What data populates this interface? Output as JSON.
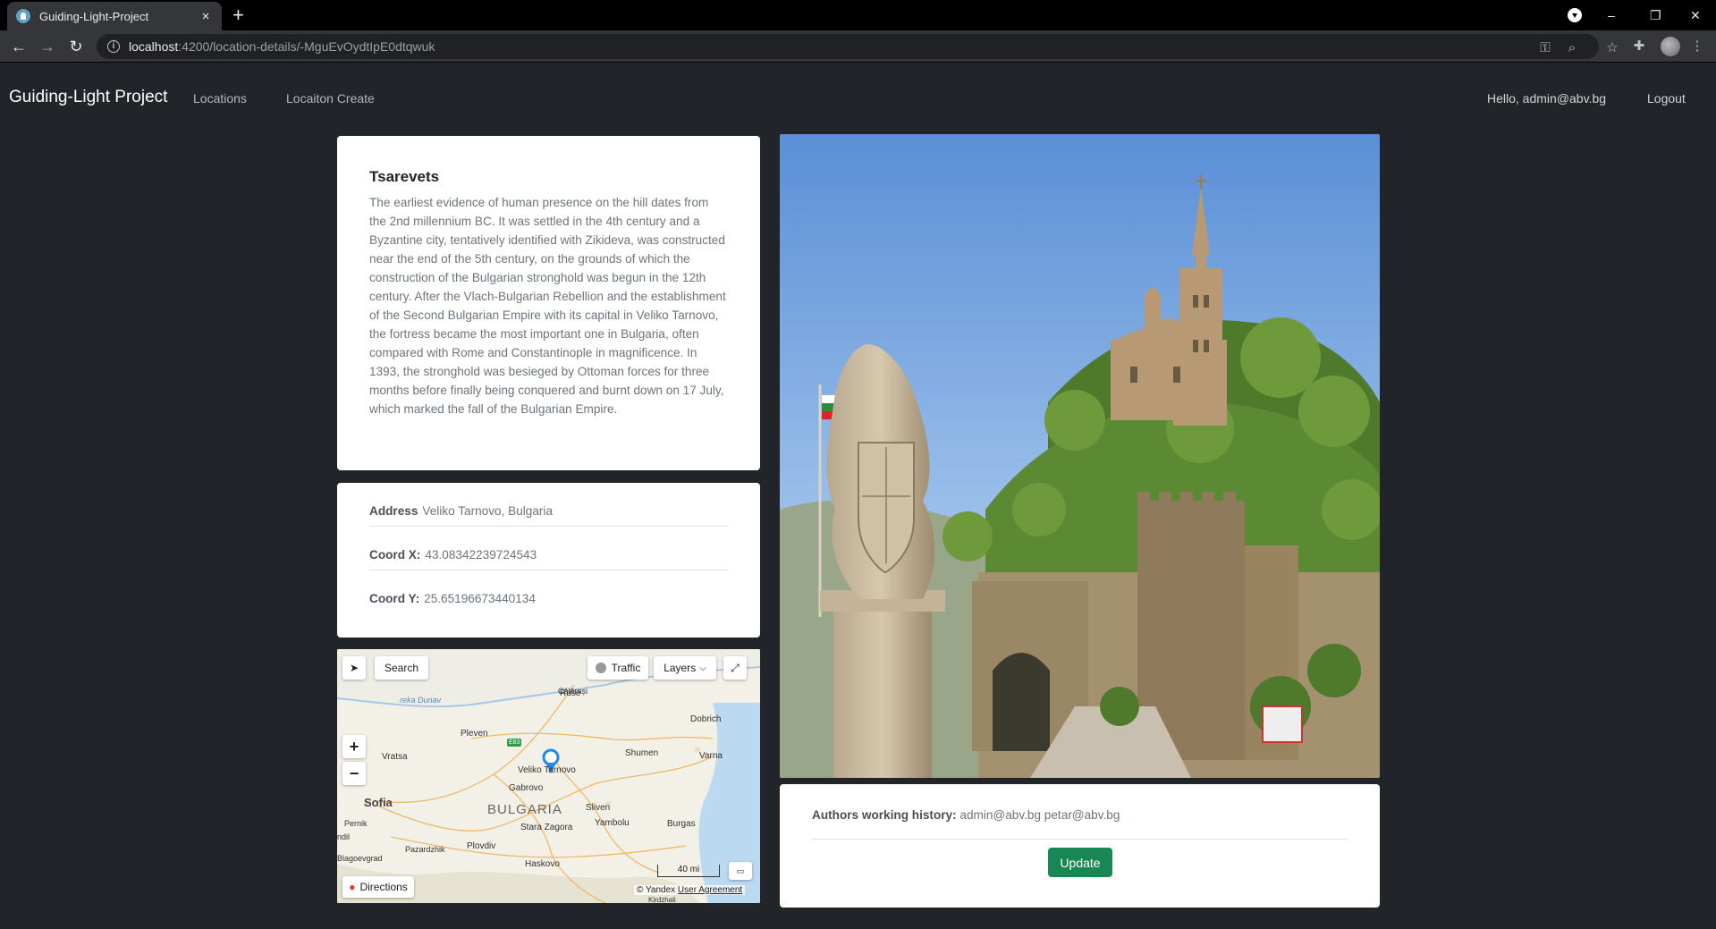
{
  "browser": {
    "tab_title": "Guiding-Light-Project",
    "tab_close": "×",
    "new_tab": "+",
    "url_host": "localhost",
    "url_path": ":4200/location-details/-MguEvOydtIpE0dtqwuk",
    "minimize": "–",
    "restore": "❐",
    "close": "✕"
  },
  "navbar": {
    "brand": "Guiding-Light Project",
    "links": [
      "Locations",
      "Locaiton Create"
    ],
    "greeting": "Hello, admin@abv.bg",
    "logout": "Logout"
  },
  "location": {
    "title": "Tsarevets",
    "description": "The earliest evidence of human presence on the hill dates from the 2nd millennium BC. It was settled in the 4th century and a Byzantine city, tentatively identified with Zikideva, was constructed near the end of the 5th century, on the grounds of which the construction of the Bulgarian stronghold was begun in the 12th century. After the Vlach-Bulgarian Rebellion and the establishment of the Second Bulgarian Empire with its capital in Veliko Tarnovo, the fortress became the most important one in Bulgaria, often compared with Rome and Constantinople in magnificence. In 1393, the stronghold was besieged by Ottoman forces for three months before finally being conquered and burnt down on 17 July, which marked the fall of the Bulgarian Empire.",
    "address_label": "Address",
    "address": "Veliko Tarnovo, Bulgaria",
    "coord_x_label": "Coord X:",
    "coord_x": "43.08342239724543",
    "coord_y_label": "Coord Y:",
    "coord_y": "25.65196673440134"
  },
  "map": {
    "search": "Search",
    "traffic": "Traffic",
    "layers": "Layers",
    "directions": "Directions",
    "scale": "40 mi",
    "attribution": "© Yandex",
    "agreement": "User Agreement",
    "labels": [
      "Ruse",
      "Dobrich",
      "Pleven",
      "Shumen",
      "Varna",
      "Vratsa",
      "Veliko Tarnovo",
      "Gabrovo",
      "Sofia",
      "BULGARIA",
      "Sliven",
      "Burgas",
      "Yambolu",
      "Pernik",
      "Stara Zagora",
      "Plovdiv",
      "Pazardzhik",
      "Haskovo",
      "Blagoevgrad",
      "Călărași",
      "reka Dunav",
      "E83",
      "ndil",
      "Kirdzhali"
    ]
  },
  "authors": {
    "label": "Authors working history:",
    "names": "admin@abv.bg petar@abv.bg",
    "update_button": "Update"
  }
}
